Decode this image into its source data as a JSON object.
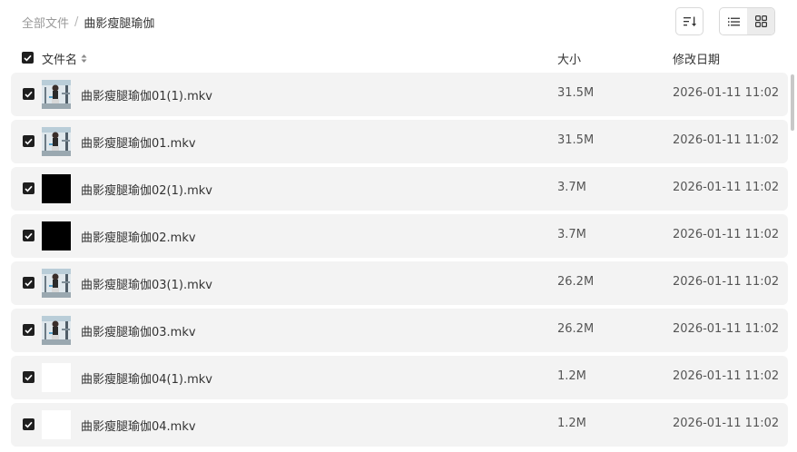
{
  "breadcrumb": {
    "root": "全部文件",
    "separator": "/",
    "current": "曲影瘦腿瑜伽"
  },
  "toolbar": {
    "sort_icon": "sort-icon",
    "list_view_icon": "list-view-icon",
    "grid_view_icon": "grid-view-icon",
    "active_view": "list"
  },
  "table": {
    "headers": {
      "name": "文件名",
      "size": "大小",
      "date": "修改日期"
    },
    "rows": [
      {
        "name": "曲影瘦腿瑜伽01(1).mkv",
        "size": "31.5M",
        "date": "2026-01-11 11:02",
        "thumb": "video",
        "checked": true
      },
      {
        "name": "曲影瘦腿瑜伽01.mkv",
        "size": "31.5M",
        "date": "2026-01-11 11:02",
        "thumb": "video",
        "checked": true
      },
      {
        "name": "曲影瘦腿瑜伽02(1).mkv",
        "size": "3.7M",
        "date": "2026-01-11 11:02",
        "thumb": "black",
        "checked": true
      },
      {
        "name": "曲影瘦腿瑜伽02.mkv",
        "size": "3.7M",
        "date": "2026-01-11 11:02",
        "thumb": "black",
        "checked": true
      },
      {
        "name": "曲影瘦腿瑜伽03(1).mkv",
        "size": "26.2M",
        "date": "2026-01-11 11:02",
        "thumb": "video",
        "checked": true
      },
      {
        "name": "曲影瘦腿瑜伽03.mkv",
        "size": "26.2M",
        "date": "2026-01-11 11:02",
        "thumb": "video",
        "checked": true
      },
      {
        "name": "曲影瘦腿瑜伽04(1).mkv",
        "size": "1.2M",
        "date": "2026-01-11 11:02",
        "thumb": "white",
        "checked": true
      },
      {
        "name": "曲影瘦腿瑜伽04.mkv",
        "size": "1.2M",
        "date": "2026-01-11 11:02",
        "thumb": "white",
        "checked": true
      }
    ]
  },
  "colors": {
    "row_background": "#f3f3f3",
    "checkbox": "#1f1f1f"
  }
}
